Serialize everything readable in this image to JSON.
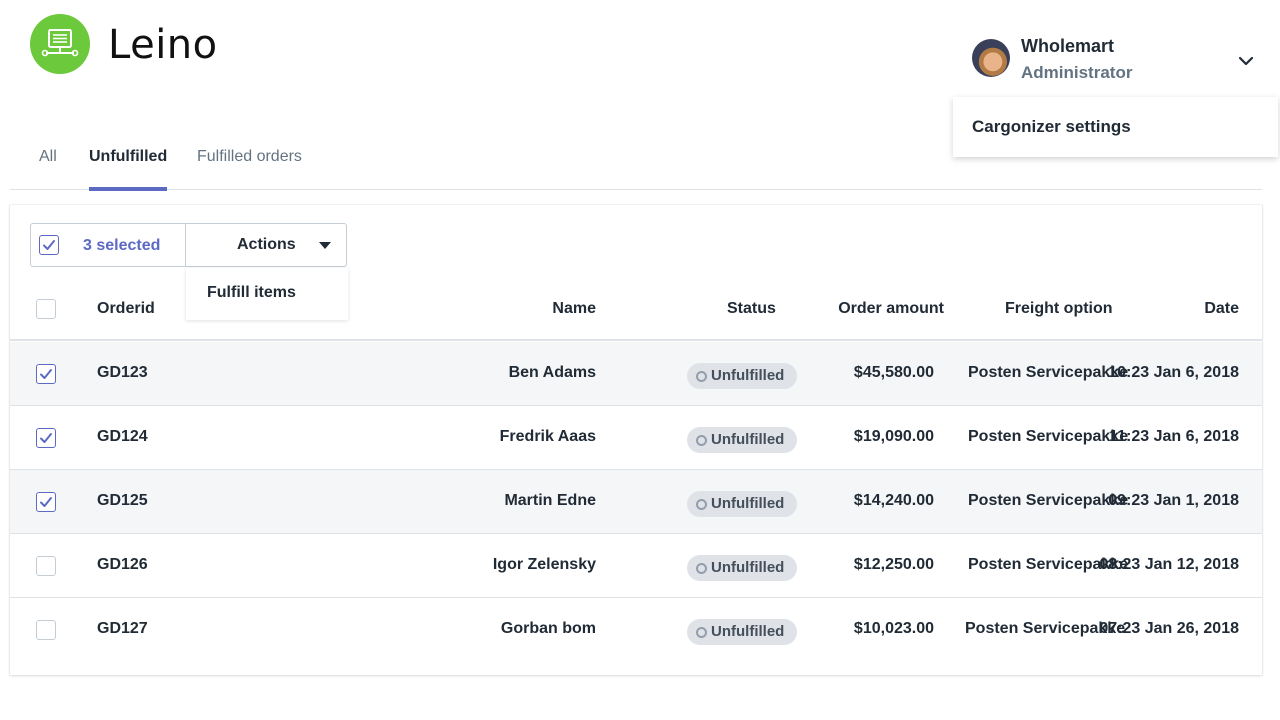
{
  "app": {
    "name": "Leino"
  },
  "user": {
    "name": "Wholemart",
    "role": "Administrator"
  },
  "user_menu": {
    "items": [
      "Cargonizer settings"
    ]
  },
  "tabs": [
    {
      "label": "All",
      "active": false
    },
    {
      "label": "Unfulfilled",
      "active": true
    },
    {
      "label": "Fulfilled orders",
      "active": false
    }
  ],
  "bulk": {
    "selected_label": "3 selected",
    "actions_label": "Actions"
  },
  "actions_menu": {
    "items": [
      "Fulfill items"
    ]
  },
  "table": {
    "headers": {
      "orderid": "Orderid",
      "name": "Name",
      "status": "Status",
      "amount": "Order amount",
      "freight": "Freight option",
      "date": "Date"
    },
    "rows": [
      {
        "checked": true,
        "orderid": "GD123",
        "name": "Ben Adams",
        "status": "Unfulfilled",
        "amount": "$45,580.00",
        "freight": "Posten Servicepakke",
        "date": "10:23 Jan 6, 2018"
      },
      {
        "checked": true,
        "orderid": "GD124",
        "name": "Fredrik Aaas",
        "status": "Unfulfilled",
        "amount": "$19,090.00",
        "freight": "Posten Servicepakke",
        "date": "11:23 Jan 6, 2018"
      },
      {
        "checked": true,
        "orderid": "GD125",
        "name": "Martin Edne",
        "status": "Unfulfilled",
        "amount": "$14,240.00",
        "freight": "Posten Servicepakke",
        "date": "09:23 Jan 1, 2018"
      },
      {
        "checked": false,
        "orderid": "GD126",
        "name": "Igor Zelensky",
        "status": "Unfulfilled",
        "amount": "$12,250.00",
        "freight": "Posten Servicepakke",
        "date": "08:23 Jan 12, 2018"
      },
      {
        "checked": false,
        "orderid": "GD127",
        "name": "Gorban bom",
        "status": "Unfulfilled",
        "amount": "$10,023.00",
        "freight": "Posten Servicepakke",
        "date": "07:23 Jan 26, 2018"
      }
    ]
  },
  "colors": {
    "brand": "#6cc93b",
    "accent": "#5c6ac4",
    "row_shade": "#f4f6f8",
    "badge": "#dfe3e8"
  },
  "icons": {
    "logo": "monitor-icon",
    "user_menu": "chevron-down-icon",
    "checkbox": "checkmark-icon",
    "actions": "caret-down-icon",
    "status": "circle-outline-icon"
  }
}
